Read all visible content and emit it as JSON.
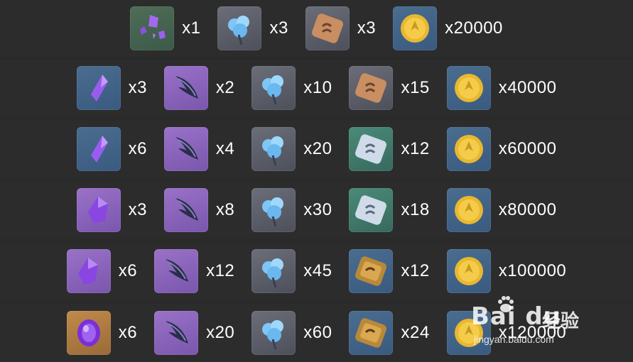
{
  "rows": [
    {
      "items": [
        {
          "icon": "purple-shards-icon",
          "qty": "x1"
        },
        {
          "icon": "blue-flower-icon",
          "qty": "x3"
        },
        {
          "icon": "bronze-scroll-icon",
          "qty": "x3"
        },
        {
          "icon": "gold-coin-icon",
          "qty": "x20000"
        }
      ]
    },
    {
      "items": [
        {
          "icon": "purple-crystal-icon",
          "qty": "x3"
        },
        {
          "icon": "dark-feather-icon",
          "qty": "x2"
        },
        {
          "icon": "blue-flower-icon",
          "qty": "x10"
        },
        {
          "icon": "bronze-scroll-icon",
          "qty": "x15"
        },
        {
          "icon": "gold-coin-icon",
          "qty": "x40000"
        }
      ]
    },
    {
      "items": [
        {
          "icon": "purple-crystal-icon",
          "qty": "x6"
        },
        {
          "icon": "dark-feather-icon",
          "qty": "x4"
        },
        {
          "icon": "blue-flower-icon",
          "qty": "x20"
        },
        {
          "icon": "silver-scroll-icon",
          "qty": "x12"
        },
        {
          "icon": "gold-coin-icon",
          "qty": "x60000"
        }
      ]
    },
    {
      "items": [
        {
          "icon": "purple-chunk-icon",
          "qty": "x3"
        },
        {
          "icon": "dark-feather-icon",
          "qty": "x8"
        },
        {
          "icon": "blue-flower-icon",
          "qty": "x30"
        },
        {
          "icon": "silver-scroll-icon",
          "qty": "x18"
        },
        {
          "icon": "gold-coin-icon",
          "qty": "x80000"
        }
      ]
    },
    {
      "items": [
        {
          "icon": "purple-chunk-icon",
          "qty": "x6"
        },
        {
          "icon": "dark-feather-icon",
          "qty": "x12"
        },
        {
          "icon": "blue-flower-icon",
          "qty": "x45"
        },
        {
          "icon": "gold-scroll-icon",
          "qty": "x12"
        },
        {
          "icon": "gold-coin-icon",
          "qty": "x100000"
        }
      ]
    },
    {
      "items": [
        {
          "icon": "purple-gem-icon",
          "qty": "x6"
        },
        {
          "icon": "dark-feather-icon",
          "qty": "x20"
        },
        {
          "icon": "blue-flower-icon",
          "qty": "x60"
        },
        {
          "icon": "gold-scroll-icon",
          "qty": "x24"
        },
        {
          "icon": "gold-coin-icon",
          "qty": "x120000"
        }
      ]
    }
  ],
  "watermark": {
    "logo": "Bai  du",
    "cn": "经验",
    "url": "jingyan.baidu.com"
  }
}
